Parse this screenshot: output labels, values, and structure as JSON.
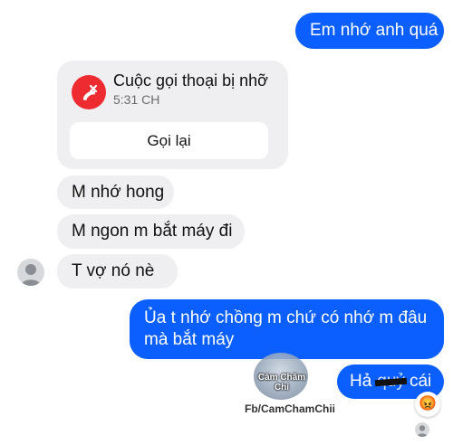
{
  "messages": {
    "out_1": "Em nhớ anh quá",
    "in_1": "M nhớ hong",
    "in_2": "M ngon m bắt máy đi",
    "in_3": "T vợ nó nè",
    "out_2_line1": "Ủa t nhớ chồng m chứ có nhớ m đâu",
    "out_2_line2": "mà bắt máy",
    "out_3_start": "Hả",
    "out_3_struck": "quỷ",
    "out_3_end": "cái"
  },
  "missed_call": {
    "title": "Cuộc gọi thoại bị nhỡ",
    "time": "5:31 CH",
    "callback_label": "Gọi lại",
    "icon": "missed-call-icon",
    "icon_color": "#ee2b30"
  },
  "reaction": {
    "emoji": "😡",
    "icon": "angry-face-icon"
  },
  "watermark": {
    "name": "Cám Chăm Chỉ",
    "handle": "Fb/CamChamChii"
  },
  "colors": {
    "outgoing_bubble": "#0b5fff",
    "incoming_bubble": "#efeff1"
  }
}
